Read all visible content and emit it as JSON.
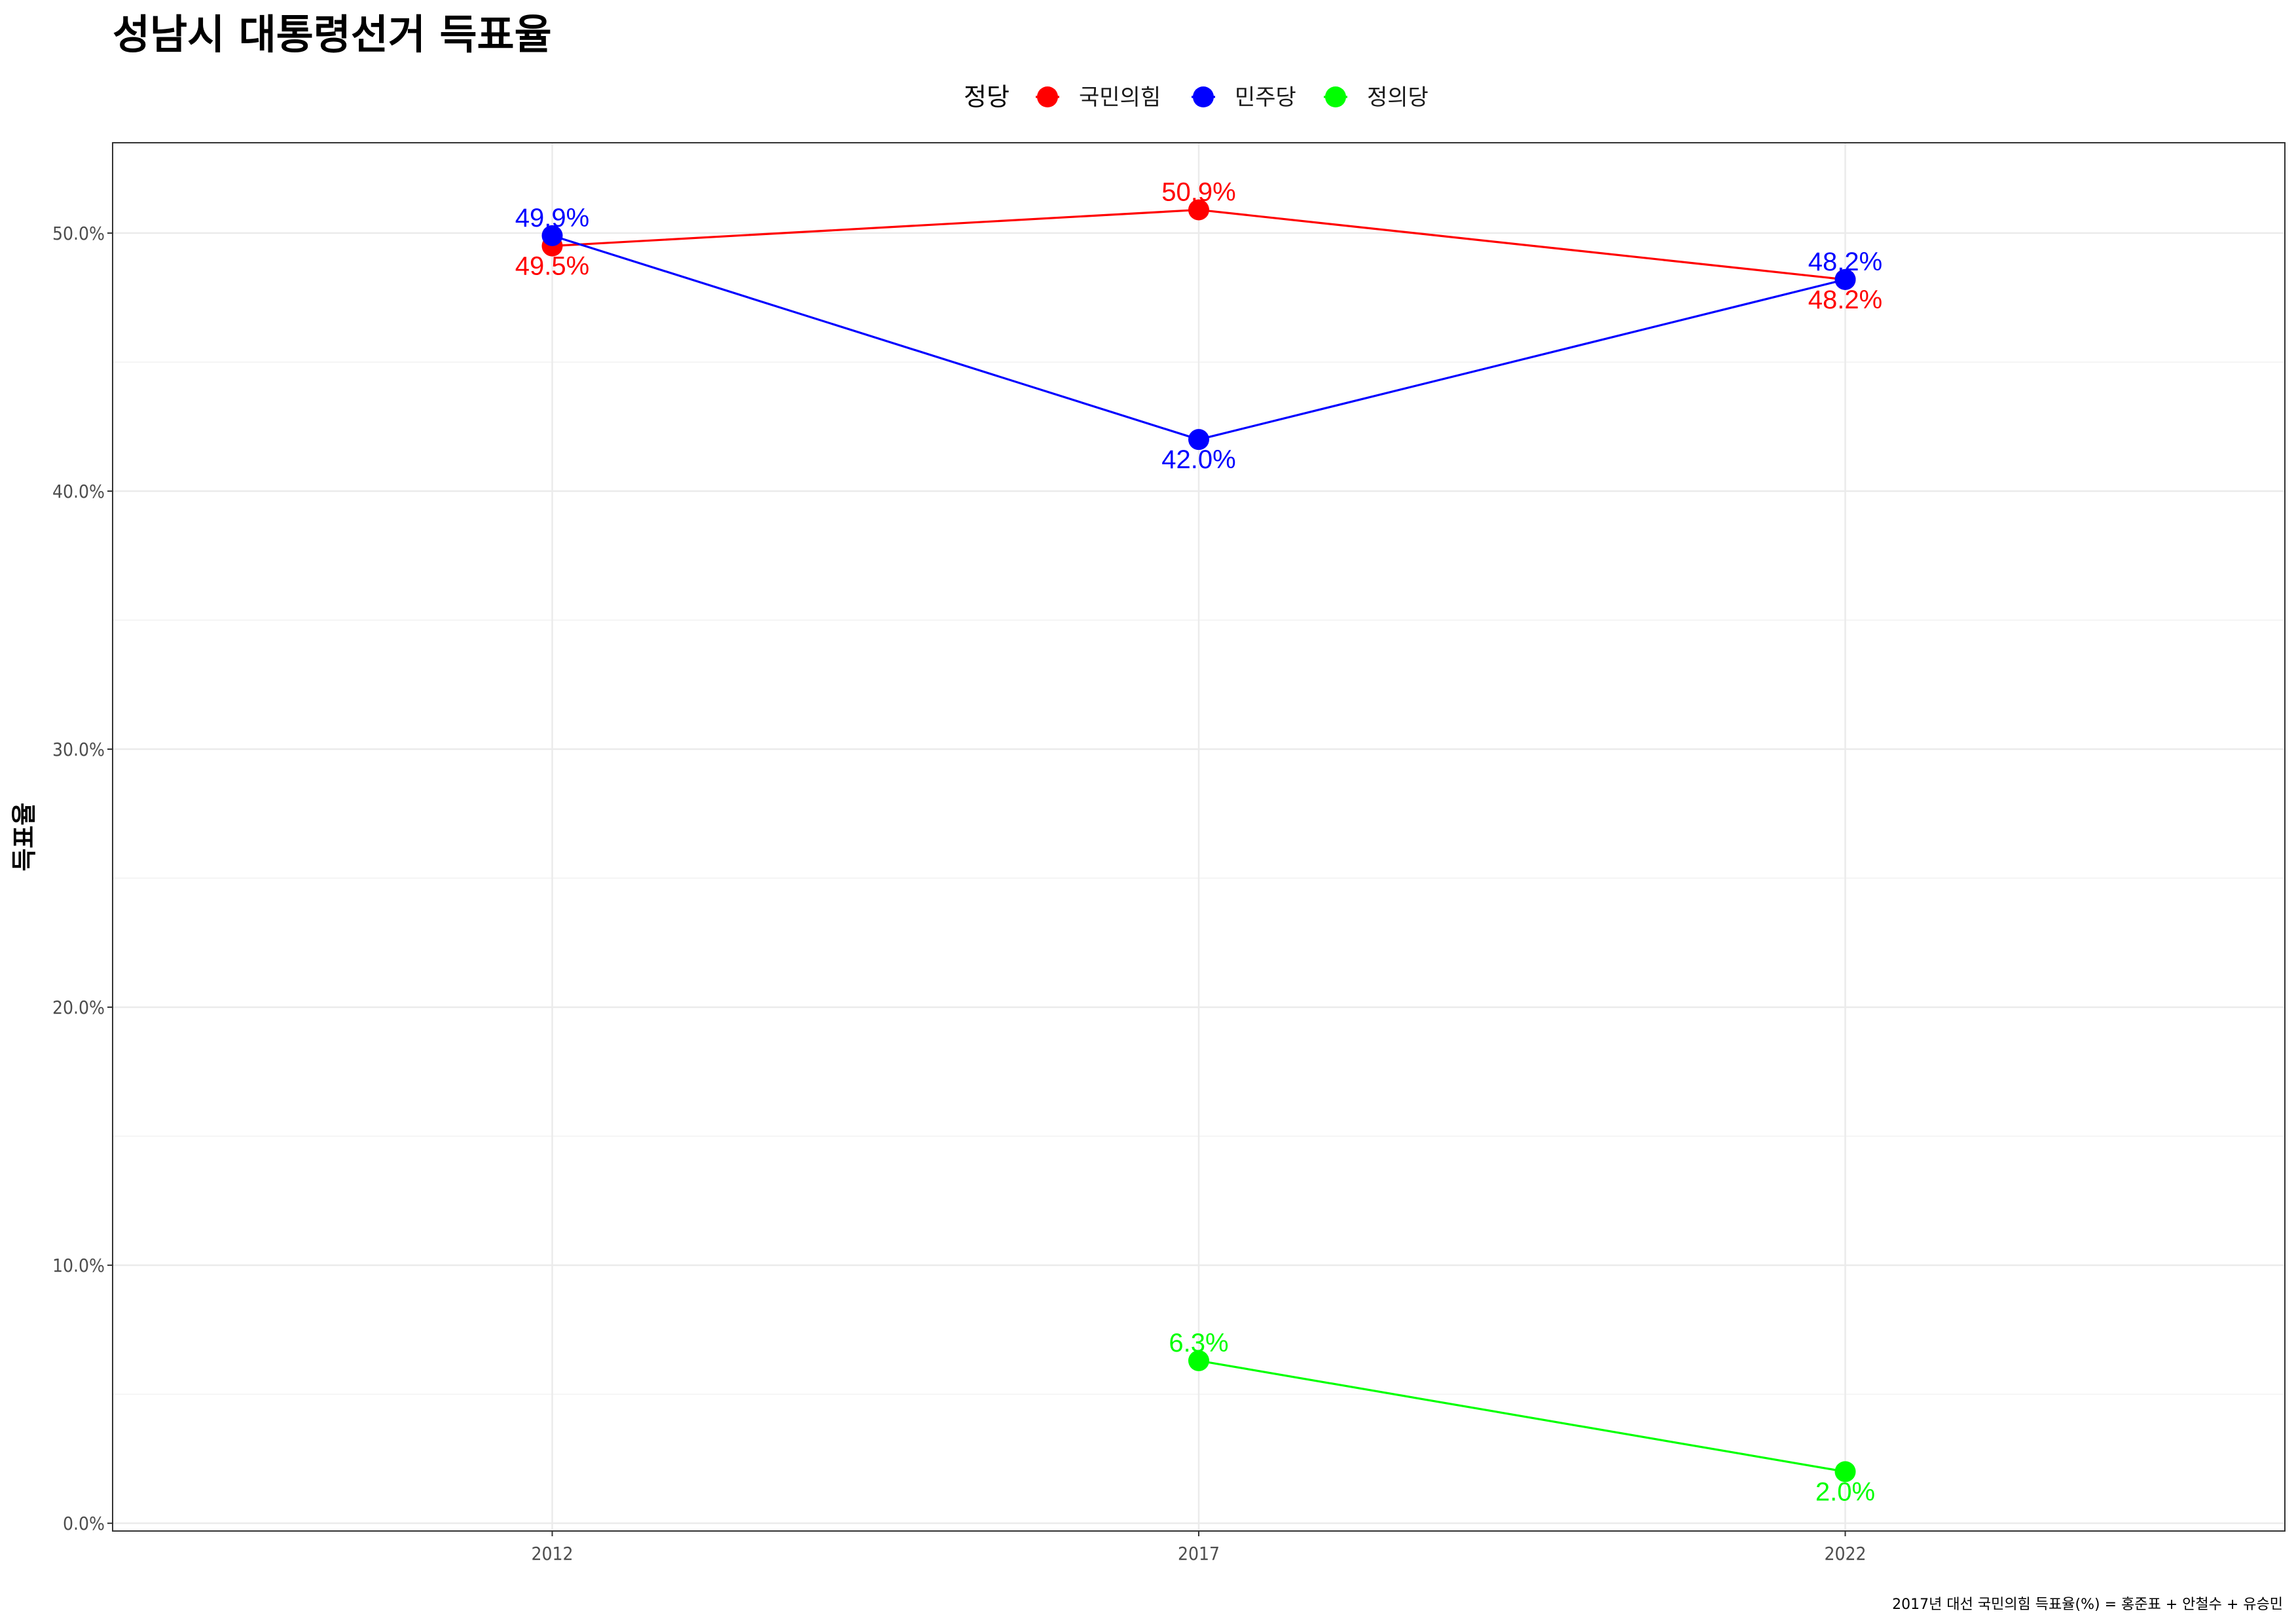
{
  "chart_data": {
    "type": "line",
    "title": "성남시 대통령선거 득표율",
    "ylabel": "득표율",
    "xlabel": "",
    "caption": "2017년 대선 국민의힘 득표율(%) = 홍준표 + 안철수 + 유승민",
    "legend_title": "정당",
    "legend_position": "top",
    "grid": true,
    "x": [
      2012,
      2017,
      2022
    ],
    "ylim": [
      0,
      53.5
    ],
    "yticks": [
      0,
      10,
      20,
      30,
      40,
      50
    ],
    "ytick_labels": [
      "0.0%",
      "10.0%",
      "20.0%",
      "30.0%",
      "40.0%",
      "50.0%"
    ],
    "xtick_labels": [
      "2012",
      "2017",
      "2022"
    ],
    "series": [
      {
        "name": "국민의힘",
        "color": "#ff0000",
        "points": [
          {
            "x": 2012,
            "y": 49.5,
            "label": "49.5%",
            "pos": "below"
          },
          {
            "x": 2017,
            "y": 50.9,
            "label": "50.9%",
            "pos": "above"
          },
          {
            "x": 2022,
            "y": 48.2,
            "label": "48.2%",
            "pos": "below"
          }
        ]
      },
      {
        "name": "민주당",
        "color": "#0000ff",
        "points": [
          {
            "x": 2012,
            "y": 49.9,
            "label": "49.9%",
            "pos": "above"
          },
          {
            "x": 2017,
            "y": 42.0,
            "label": "42.0%",
            "pos": "below"
          },
          {
            "x": 2022,
            "y": 48.2,
            "label": "48.2%",
            "pos": "above"
          }
        ]
      },
      {
        "name": "정의당",
        "color": "#00ff00",
        "points": [
          {
            "x": 2017,
            "y": 6.3,
            "label": "6.3%",
            "pos": "above"
          },
          {
            "x": 2022,
            "y": 2.0,
            "label": "2.0%",
            "pos": "below"
          }
        ]
      }
    ]
  }
}
